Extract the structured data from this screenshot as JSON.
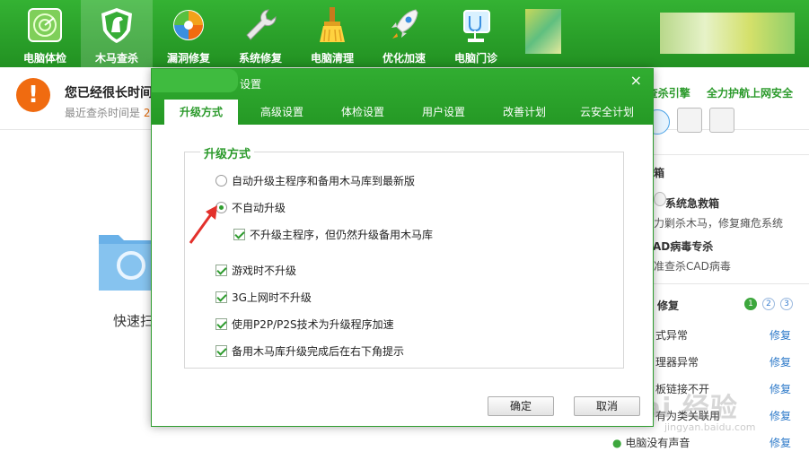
{
  "toolbar": {
    "items": [
      {
        "label": "电脑体检",
        "icon": "radar-icon"
      },
      {
        "label": "木马查杀",
        "icon": "horse-shield-icon"
      },
      {
        "label": "漏洞修复",
        "icon": "windows-patch-icon"
      },
      {
        "label": "系统修复",
        "icon": "wrench-icon"
      },
      {
        "label": "电脑清理",
        "icon": "broom-icon"
      },
      {
        "label": "优化加速",
        "icon": "rocket-icon"
      },
      {
        "label": "电脑门诊",
        "icon": "stethoscope-icon"
      }
    ],
    "active_index": 1
  },
  "status": {
    "title": "您已经很长时间",
    "subtitle_prefix": "最近查杀时间是",
    "subtitle_value": "2",
    "links": [
      "查杀引擎",
      "全力护航上网安全"
    ]
  },
  "main": {
    "quick_scan_label": "快速扫"
  },
  "right_panel": {
    "toolbox_title": "箱",
    "tools": [
      {
        "title": "系统急救箱",
        "desc": "力剿杀木马，修复瘫危系统"
      },
      {
        "title": "AD病毒专杀",
        "desc": "准查杀CAD病毒"
      }
    ],
    "repair_title": "修复",
    "pages": [
      "1",
      "2",
      "3"
    ],
    "issues": [
      {
        "text": "式异常",
        "action": "修复"
      },
      {
        "text": "理器异常",
        "action": "修复"
      },
      {
        "text": "板链接不开",
        "action": "修复"
      },
      {
        "text": "有为类关联用",
        "action": "修复"
      },
      {
        "text": "电脑没有声音",
        "action": "修复"
      }
    ],
    "watermark": "Bai 经验",
    "watermark_sub": "jingyan.baidu.com"
  },
  "dialog": {
    "title": "设置",
    "close": "×",
    "tabs": [
      "升级方式",
      "高级设置",
      "体检设置",
      "用户设置",
      "改善计划",
      "云安全计划"
    ],
    "active_tab": 0,
    "group_title": "升级方式",
    "radios": [
      {
        "label": "自动升级主程序和备用木马库到最新版",
        "checked": false
      },
      {
        "label": "不自动升级",
        "checked": true
      }
    ],
    "sub_checkbox": {
      "label": "不升级主程序，但仍然升级备用木马库",
      "checked": true
    },
    "checkboxes": [
      {
        "label": "游戏时不升级",
        "checked": true
      },
      {
        "label": "3G上网时不升级",
        "checked": true
      },
      {
        "label": "使用P2P/P2S技术为升级程序加速",
        "checked": true
      },
      {
        "label": "备用木马库升级完成后在右下角提示",
        "checked": true
      }
    ],
    "ok_label": "确定",
    "cancel_label": "取消"
  },
  "colors": {
    "brand_green": "#2a9f2a",
    "tab_active_text": "#2b9a2b",
    "warning_orange": "#f06b10",
    "link_blue": "#2e7ac9",
    "arrow_red": "#e3302b"
  }
}
